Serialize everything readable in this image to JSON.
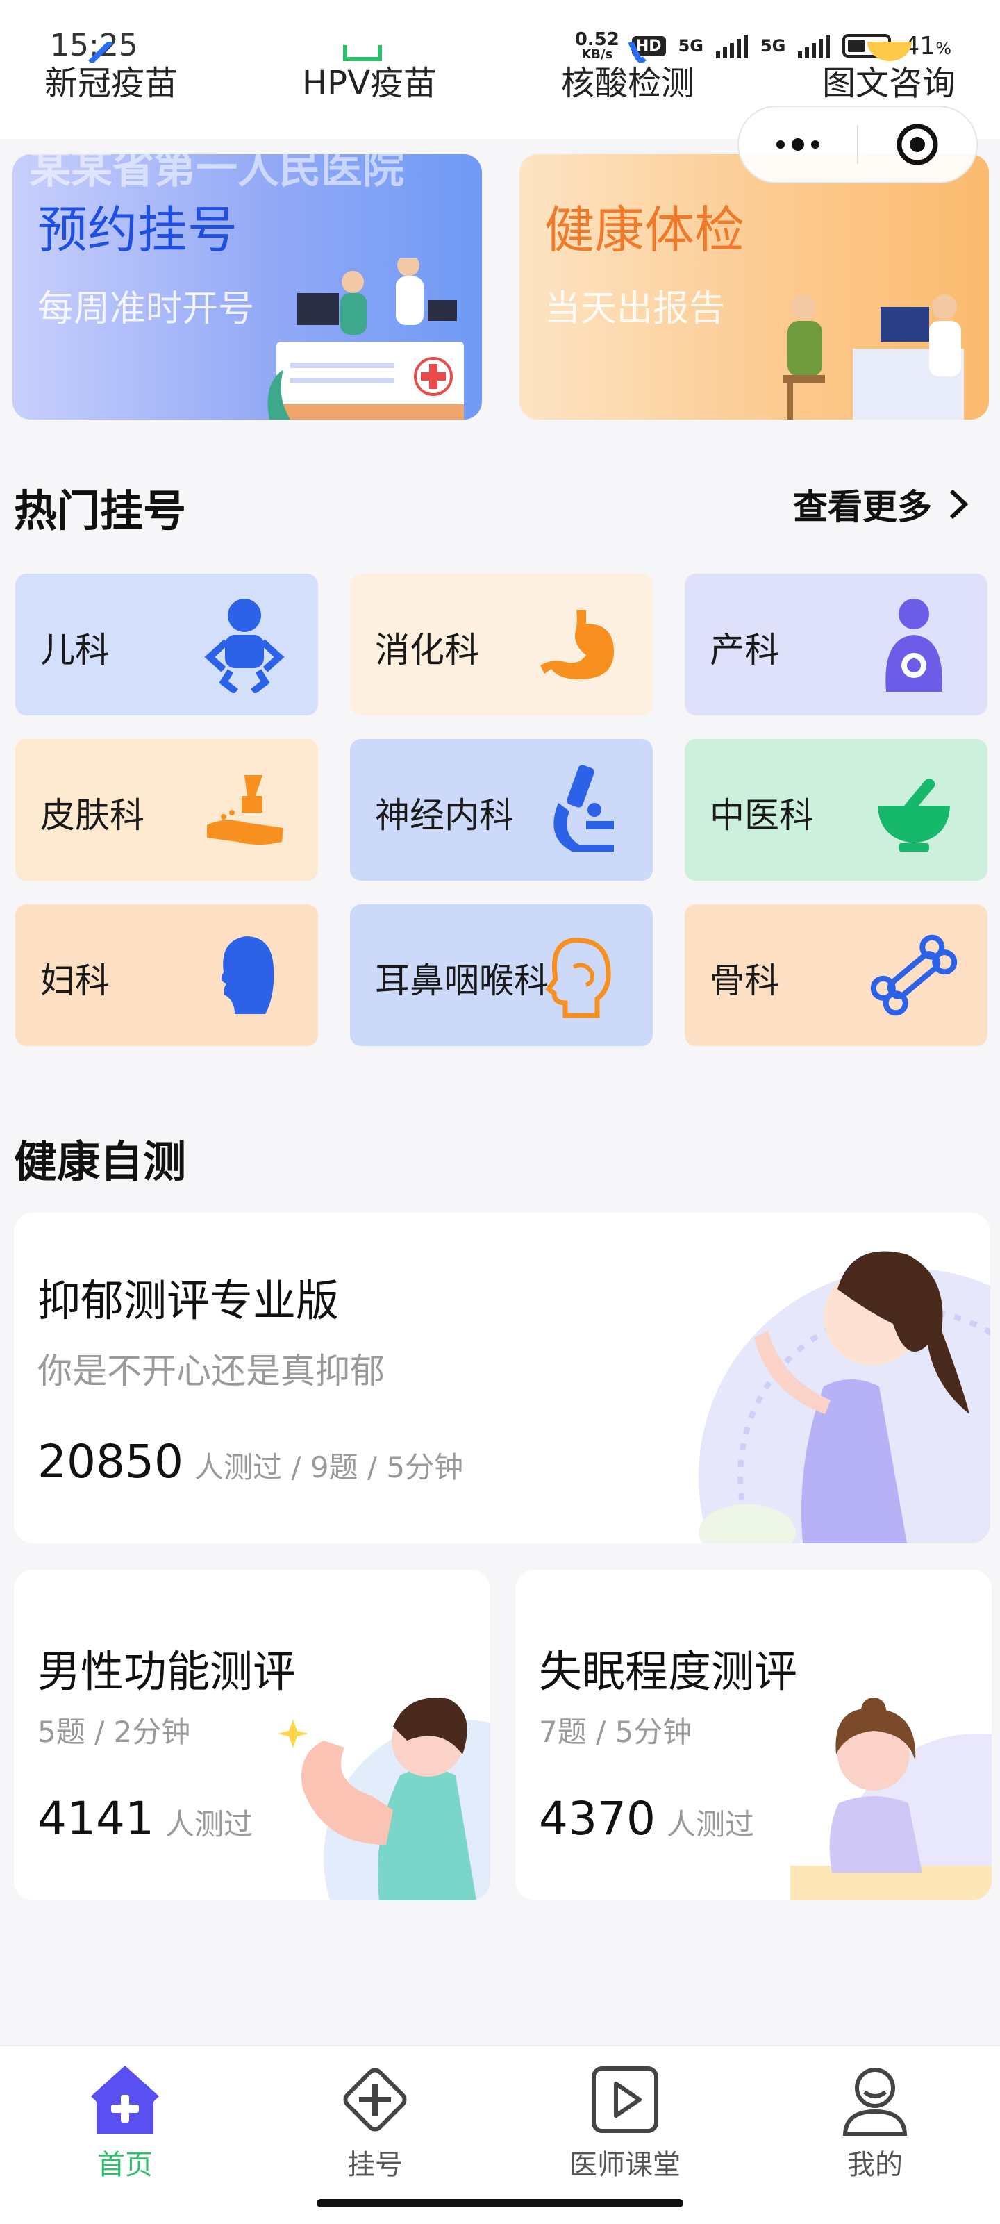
{
  "status_bar": {
    "time": "15:25",
    "speed_value": "0.52",
    "speed_unit": "KB/s",
    "hd": "HD",
    "network_1": "5G",
    "network_2": "5G",
    "battery": "41",
    "battery_unit": "%"
  },
  "quick_nav": [
    {
      "label": "新冠疫苗"
    },
    {
      "label": "HPV疫苗"
    },
    {
      "label": "核酸检测"
    },
    {
      "label": "图文咨询"
    }
  ],
  "banners": {
    "left": {
      "title": "预约挂号",
      "subtitle": "每周准时开号",
      "peek_text": "某某省第一人民医院"
    },
    "right": {
      "title": "健康体检",
      "subtitle": "当天出报告"
    }
  },
  "hot_section": {
    "title": "热门挂号",
    "see_more": "查看更多",
    "departments": [
      {
        "label": "儿科",
        "icon": "baby-icon",
        "bg": "#d4e0fb"
      },
      {
        "label": "消化科",
        "icon": "stomach-icon",
        "bg": "#fdf0e0"
      },
      {
        "label": "产科",
        "icon": "mother-baby-icon",
        "bg": "#dfe0fa"
      },
      {
        "label": "皮肤科",
        "icon": "skin-cream-icon",
        "bg": "#fde8d0"
      },
      {
        "label": "神经内科",
        "icon": "microscope-icon",
        "bg": "#cdd9f9"
      },
      {
        "label": "中医科",
        "icon": "mortar-icon",
        "bg": "#cdf0dd"
      },
      {
        "label": "妇科",
        "icon": "woman-head-icon",
        "bg": "#fde0c4"
      },
      {
        "label": "耳鼻咽喉科",
        "icon": "ent-head-icon",
        "bg": "#cdd9f9"
      },
      {
        "label": "骨科",
        "icon": "bone-icon",
        "bg": "#fde0c4"
      }
    ]
  },
  "self_test": {
    "title": "健康自测",
    "cards": [
      {
        "title": "抑郁测评专业版",
        "subtitle": "你是不开心还是真抑郁",
        "count": "20850",
        "meta": "人测过 / 9题 / 5分钟"
      },
      {
        "title": "男性功能测评",
        "subtitle": "5题 / 2分钟",
        "count": "4141",
        "meta": "人测过"
      },
      {
        "title": "失眠程度测评",
        "subtitle": "7题 / 5分钟",
        "count": "4370",
        "meta": "人测过"
      }
    ]
  },
  "tabbar": {
    "active_color": "#2fbf6b",
    "items": [
      {
        "label": "首页",
        "icon": "home-icon"
      },
      {
        "label": "挂号",
        "icon": "plus-diamond-icon"
      },
      {
        "label": "医师课堂",
        "icon": "play-video-icon"
      },
      {
        "label": "我的",
        "icon": "user-icon"
      }
    ]
  }
}
